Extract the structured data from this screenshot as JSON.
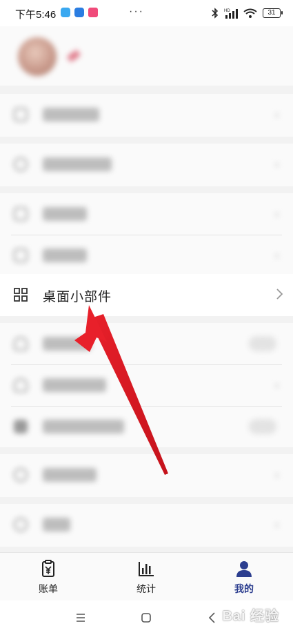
{
  "status_bar": {
    "time": "下午5:46",
    "battery": "31",
    "more": "···",
    "network": "HD"
  },
  "profile": {
    "avatar": "avatar"
  },
  "widget_row": {
    "label": "桌面小部件"
  },
  "tabs": [
    {
      "label": "账单",
      "icon": "receipt-yen-icon",
      "active": false
    },
    {
      "label": "统计",
      "icon": "bar-chart-icon",
      "active": false
    },
    {
      "label": "我的",
      "icon": "person-icon",
      "active": true
    }
  ],
  "colors": {
    "active_tab": "#2c3e8f",
    "inactive_tab": "#222222",
    "arrow": "#e8202a"
  },
  "watermark": "Bai 经验"
}
